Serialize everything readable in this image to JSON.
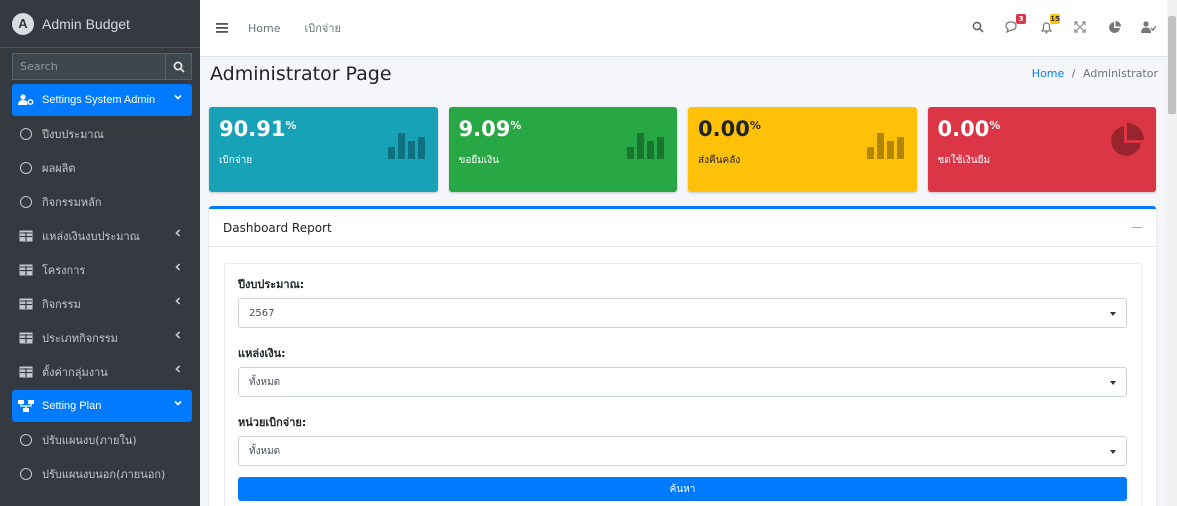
{
  "brand": {
    "title": "Admin Budget",
    "logo_letter": "A"
  },
  "sidebar": {
    "search_placeholder": "Search",
    "items": [
      {
        "label": "Settings System Admin",
        "icon": "users-cog-icon",
        "active": true
      },
      {
        "label": "ปีงบประมาณ",
        "icon": "circle-icon"
      },
      {
        "label": "ผลผลิต",
        "icon": "circle-icon"
      },
      {
        "label": "กิจกรรมหลัก",
        "icon": "circle-icon"
      },
      {
        "label": "แหล่งเงินงบประมาณ",
        "icon": "table-icon"
      },
      {
        "label": "โครงการ",
        "icon": "table-icon"
      },
      {
        "label": "กิจกรรม",
        "icon": "table-icon"
      },
      {
        "label": "ประเภทกิจกรรม",
        "icon": "table-icon"
      },
      {
        "label": "ตั้งค่ากลุ่มงาน",
        "icon": "table-icon"
      },
      {
        "label": "Setting Plan",
        "icon": "sitemap-icon",
        "active": true
      },
      {
        "label": "ปรับแผนงบ(ภายใน)",
        "icon": "circle-icon"
      },
      {
        "label": "ปรับแผนงบนอก(ภายนอก)",
        "icon": "circle-icon"
      }
    ]
  },
  "topbar": {
    "links": [
      "Home",
      "เบิกจ่าย"
    ],
    "messages_badge": "3",
    "notifications_badge": "15"
  },
  "header": {
    "title": "Administrator Page",
    "breadcrumb_home": "Home",
    "breadcrumb_sep": "/",
    "breadcrumb_current": "Administrator"
  },
  "boxes": [
    {
      "value": "90.91",
      "unit": "%",
      "label": "เบิกจ่าย",
      "color": "#17a2b8"
    },
    {
      "value": "9.09",
      "unit": "%",
      "label": "ขอยืมเงิน",
      "color": "#28a745"
    },
    {
      "value": "0.00",
      "unit": "%",
      "label": "ส่งคืนคลัง",
      "color": "#ffc107"
    },
    {
      "value": "0.00",
      "unit": "%",
      "label": "ชดใช้เงินยืม",
      "color": "#dc3545"
    }
  ],
  "report": {
    "title": "Dashboard Report",
    "fields": [
      {
        "label": "ปีงบประมาณ:",
        "value": "2567"
      },
      {
        "label": "แหล่งเงิน:",
        "value": "ทั้งหมด"
      },
      {
        "label": "หน่วยเบิกจ่าย:",
        "value": "ทั้งหมด"
      }
    ],
    "submit_label": "ค้นหา"
  }
}
